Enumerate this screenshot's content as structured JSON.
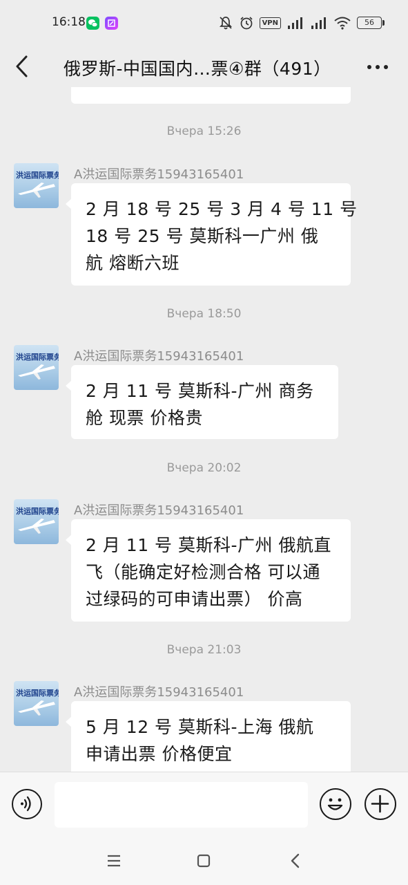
{
  "status_bar": {
    "time": "16:18",
    "vpn_label": "VPN",
    "battery": "56",
    "icons": [
      "wechat-icon",
      "app-notification-icon",
      "mute-icon",
      "alarm-icon",
      "vpn-icon",
      "signal-icon",
      "signal-hd-icon",
      "wifi-icon",
      "battery-icon"
    ]
  },
  "header": {
    "title": "俄罗斯-中国国内…票④群（491）",
    "back_icon": "chevron-left-icon",
    "more_icon": "more-dots-icon"
  },
  "messages": [
    {
      "timestamp": "Вчера 15:26",
      "sender": "A洪运国际票务15943165401",
      "avatar_text": "洪运国际票务",
      "lines": [
        "2 月 18 号 25 号  3 月 4 号 11 号",
        "18 号 25 号   莫斯科一广州  俄",
        "航   熔断六班"
      ]
    },
    {
      "timestamp": "Вчера 18:50",
      "sender": "A洪运国际票务15943165401",
      "avatar_text": "洪运国际票务",
      "lines": [
        "2 月 11 号  莫斯科-广州   商务",
        "舱  现票  价格贵"
      ]
    },
    {
      "timestamp": "Вчера 20:02",
      "sender": "A洪运国际票务15943165401",
      "avatar_text": "洪运国际票务",
      "lines": [
        "2 月 11 号  莫斯科-广州  俄航直",
        "飞（能确定好检测合格  可以通",
        "过绿码的可申请出票）  价高"
      ]
    },
    {
      "timestamp": "Вчера 21:03",
      "sender": "A洪运国际票务15943165401",
      "avatar_text": "洪运国际票务",
      "lines": [
        "5 月 12 号  莫斯科-上海  俄航",
        "申请出票  价格便宜"
      ]
    }
  ],
  "input_bar": {
    "voice_icon": "voice-icon",
    "text_value": "",
    "emoji_icon": "emoji-icon",
    "plus_icon": "plus-icon"
  },
  "nav_bar": {
    "icons": [
      "menu-icon",
      "home-icon",
      "back-icon"
    ]
  },
  "colors": {
    "background": "#ededed",
    "bubble": "#ffffff",
    "wechat_green": "#07c160"
  }
}
